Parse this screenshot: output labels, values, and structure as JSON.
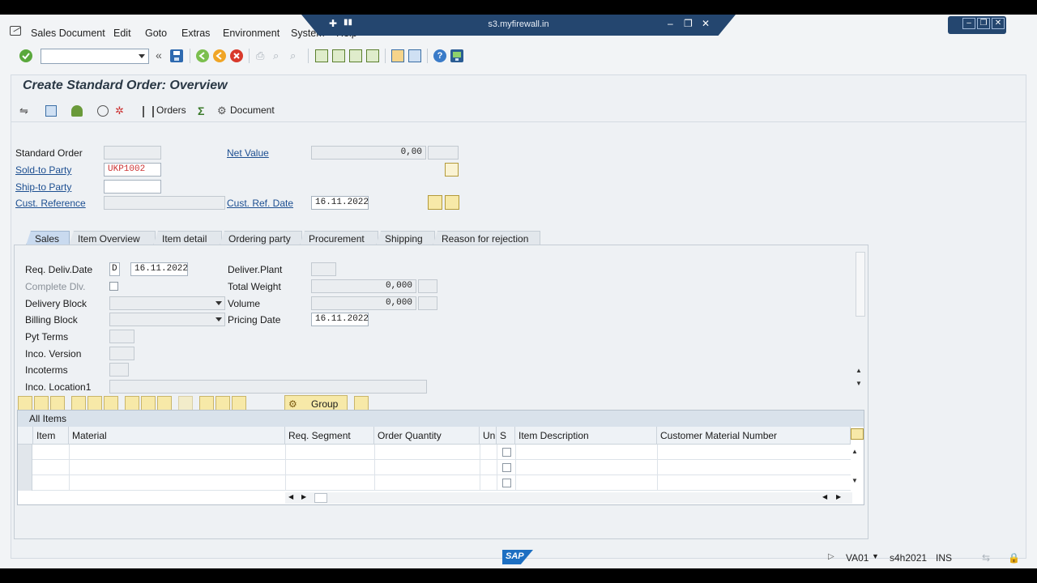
{
  "window": {
    "remote_title": "s3.myfirewall.in"
  },
  "menu": [
    "Sales Document",
    "Edit",
    "Goto",
    "Extras",
    "Environment",
    "System",
    "Help"
  ],
  "toolbar": {
    "command_field_value": "",
    "back_label": "«"
  },
  "page": {
    "title": "Create Standard Order: Overview"
  },
  "app_toolbar": {
    "orders_label": "Orders",
    "document_label": "Document"
  },
  "header": {
    "standard_order_label": "Standard Order",
    "standard_order_value": "",
    "net_value_label": "Net Value",
    "net_value": "0,00",
    "sold_to_label": "Sold-to Party",
    "sold_to_value": "UKP1002",
    "ship_to_label": "Ship-to Party",
    "ship_to_value": "",
    "cust_ref_label": "Cust. Reference",
    "cust_ref_value": "",
    "cust_ref_date_label": "Cust. Ref. Date",
    "cust_ref_date": "16.11.2022"
  },
  "tabs": [
    "Sales",
    "Item Overview",
    "Item detail",
    "Ordering party",
    "Procurement",
    "Shipping",
    "Reason for rejection"
  ],
  "sales_tab": {
    "req_deliv_label": "Req. Deliv.Date",
    "req_deliv_type": "D",
    "req_deliv_date": "16.11.2022",
    "deliver_plant_label": "Deliver.Plant",
    "complete_dlv_label": "Complete Dlv.",
    "total_weight_label": "Total Weight",
    "total_weight": "0,000",
    "delivery_block_label": "Delivery Block",
    "volume_label": "Volume",
    "volume": "0,000",
    "billing_block_label": "Billing Block",
    "pricing_date_label": "Pricing Date",
    "pricing_date": "16.11.2022",
    "pyt_terms_label": "Pyt Terms",
    "inco_version_label": "Inco. Version",
    "incoterms_label": "Incoterms",
    "inco_location_label": "Inco. Location1"
  },
  "items": {
    "group_label": "Group",
    "section_title": "All Items",
    "columns": [
      "Item",
      "Material",
      "Req. Segment",
      "Order Quantity",
      "Un",
      "S",
      "Item Description",
      "Customer Material Number"
    ]
  },
  "status": {
    "transaction": "VA01",
    "system": "s4h2021",
    "mode": "INS",
    "logo": "SAP"
  }
}
